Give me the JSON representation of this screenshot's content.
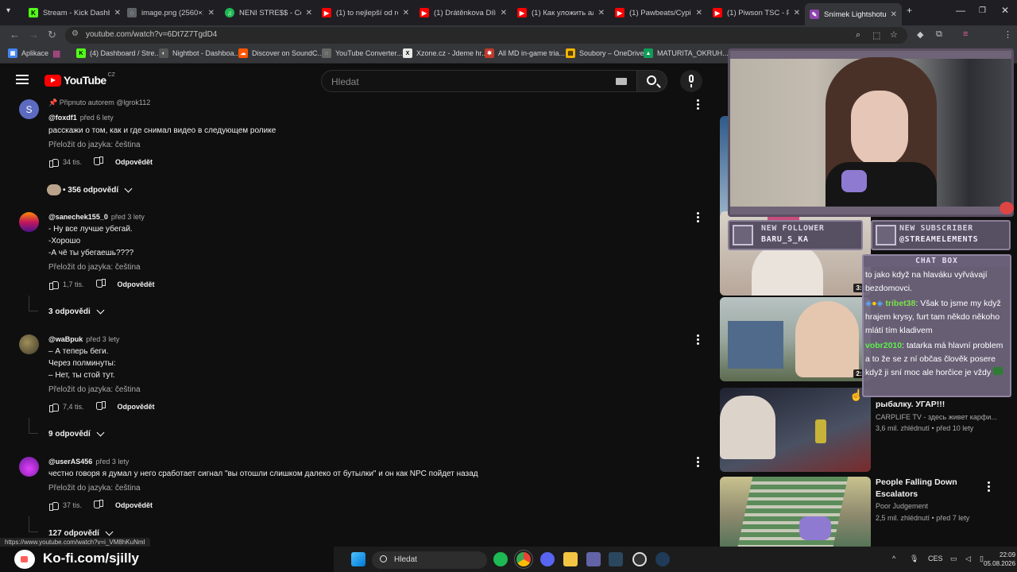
{
  "browser": {
    "tabs": [
      {
        "title": "Stream - Kick Dashbo",
        "color": "#53fc18",
        "glyph": "K"
      },
      {
        "title": "image.png (2560×14",
        "color": "#5f6368",
        "glyph": "◌"
      },
      {
        "title": "NENI STRE$$ - Cover",
        "color": "#1db954",
        "glyph": "♫"
      },
      {
        "title": "(1) to nejlepší od roi",
        "color": "#ff0000",
        "glyph": "▶"
      },
      {
        "title": "(1) Drátěnkova Dílna",
        "color": "#ff0000",
        "glyph": "▶"
      },
      {
        "title": "(1) Как уложить алк",
        "color": "#ff0000",
        "glyph": "▶"
      },
      {
        "title": "(1) Pawbeats/Cypis",
        "color": "#ff0000",
        "glyph": "▶"
      },
      {
        "title": "(1) Piwson TSC - Piwi",
        "color": "#ff0000",
        "glyph": "▶"
      },
      {
        "title": "Snímek Lightshotu",
        "color": "#8e44ad",
        "glyph": "✎"
      }
    ],
    "new_tab": "+",
    "url": "youtube.com/watch?v=6Dt7Z7TgdD4",
    "bookmarks": [
      {
        "label": "Aplikace",
        "color": "#4285f4",
        "glyph": "▦"
      },
      {
        "label": "(4) Dashboard / Stre...",
        "color": "#53fc18",
        "glyph": "K"
      },
      {
        "label": "Nightbot - Dashboa...",
        "color": "#555555",
        "glyph": "◐"
      },
      {
        "label": "Discover on SoundC...",
        "color": "#ff5500",
        "glyph": "☁"
      },
      {
        "label": "YouTube Converter...",
        "color": "#666666",
        "glyph": "◌"
      },
      {
        "label": "Xzone.cz - Jdeme hr...",
        "color": "#e8e8e8",
        "glyph": "X"
      },
      {
        "label": "All MD in-game tria...",
        "color": "#c0392b",
        "glyph": "✱"
      },
      {
        "label": "Soubory – OneDrive",
        "color": "#f4b400",
        "glyph": "▤"
      },
      {
        "label": "MATURITA_OKRUH...",
        "color": "#0f9d58",
        "glyph": "▲"
      }
    ]
  },
  "youtube": {
    "logo_text": "YouTube",
    "country": "CZ",
    "search_placeholder": "Hledat"
  },
  "comments": [
    {
      "pinned": "Připnuto autorem @lgrok112",
      "author": "@foxdf1",
      "when": "před 6 lety",
      "text": "расскажи о том, как и где снимал видео в следующем ролике",
      "translate": "Přeložit do jazyka: čeština",
      "likes": "34 tis.",
      "reply": "Odpovědět",
      "replies": "• 356 odpovědí",
      "avatar_letter": "S",
      "avatar_color": "#5c6bc0"
    },
    {
      "author": "@sanechek155_0",
      "when": "před 3 lety",
      "text": "- Ну все лучше убегай.\n-Хорошо\n-А чё ты убегаешь????",
      "translate": "Přeložit do jazyka: čeština",
      "likes": "1,7 tis.",
      "reply": "Odpovědět",
      "replies": "3 odpovědi",
      "avatar_letter": "",
      "avatar_color": "#c2185b"
    },
    {
      "author": "@waBpuk",
      "when": "před 3 lety",
      "text": "– А теперь беги.\nЧерез полминуты:\n– Нет, ты стой тут.",
      "translate": "Přeložit do jazyka: čeština",
      "likes": "7,4 tis.",
      "reply": "Odpovědět",
      "replies": "9 odpovědí",
      "avatar_letter": "",
      "avatar_color": "#6b5b3a"
    },
    {
      "author": "@userAS456",
      "when": "před 3 lety",
      "text": "честно говоря я думал у него сработает сигнал \"вы отошли слишком далеко от бутылки\" и он как NPC пойдет назад",
      "translate": "Přeložit do jazyka: čeština",
      "likes": "37 tis.",
      "reply": "Odpovědět",
      "replies": "127 odpovědí",
      "avatar_letter": "",
      "avatar_color": "#8e24aa"
    }
  ],
  "sidebar": {
    "videos": [
      {
        "duration": "3:5",
        "thumb_color": "#c9b7a6"
      },
      {
        "duration": "2:2",
        "thumb_color": "#9aa7a0"
      },
      {
        "title": "рыбалку. УГАР!!!",
        "channel": "CARPLIFE TV - здесь живет карфи...",
        "meta": "3,6 mil. zhlédnutí • před 10 lety",
        "thumb_color": "#3a3f4d"
      },
      {
        "title": "People Falling Down\nEscalators",
        "channel": "Poor Judgement",
        "meta": "2,5 mil. zhlédnutí • před 7 lety",
        "thumb_color": "#8f8a6e"
      }
    ]
  },
  "overlay": {
    "follower_title": "NEW FOLLOWER",
    "follower_name": "BARU_S_KA",
    "subscriber_title": "NEW SUBSCRIBER",
    "subscriber_name": "@STREAMELEMENTS",
    "chat_title": "CHAT BOX",
    "chat": [
      {
        "user": "",
        "msg": "to jako když na hlaváku vyřvávají bezdomovci."
      },
      {
        "user": "tribet38",
        "msg": ": Však to jsme my když hrajem krysy, furt tam někdo někoho mlátí tím kladivem",
        "user_color": "#7be34a"
      },
      {
        "user": "vobr2010",
        "msg": ": tatarka má hlavní problem a to že se z ní občas člověk posere když ji sní moc ale horčice je vždy",
        "user_color": "#5ef04a"
      }
    ]
  },
  "status_url": "https://www.youtube.com/watch?v=i_VM8hKuNmI",
  "kofi_text": "Ko-fi.com/sjilly",
  "taskbar": {
    "search_label": "Hledat",
    "lang": "CES",
    "time": "22:09",
    "date": "05.08.2026"
  }
}
